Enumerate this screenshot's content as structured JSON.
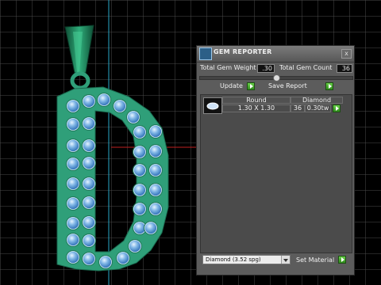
{
  "panel": {
    "title": "GEM REPORTER",
    "close_glyph": "x",
    "total_weight_label": "Total Gem Weight",
    "total_weight_value": ".30",
    "total_count_label": "Total Gem Count",
    "total_count_value": "36",
    "update_label": "Update",
    "save_report_label": "Save Report",
    "slider_level": 0.5,
    "table": {
      "columns": [
        "Round",
        "Diamond"
      ],
      "rows": [
        {
          "size": "1.30 X 1.30",
          "count": "36",
          "weight": "0.30tw"
        }
      ]
    },
    "material_select": "Diamond    (3.52 spg)",
    "set_material_label": "Set Material"
  },
  "icons": {
    "panel_icon": "gem-reporter-icon",
    "close": "close-icon",
    "go": "green-arrow-icon",
    "dropdown": "chevron-down-icon"
  },
  "colors": {
    "pendant": "#2f9f79",
    "gem": "#7fb6e6",
    "grid": "#5a5a5a",
    "panel": "#5c5c5c"
  }
}
